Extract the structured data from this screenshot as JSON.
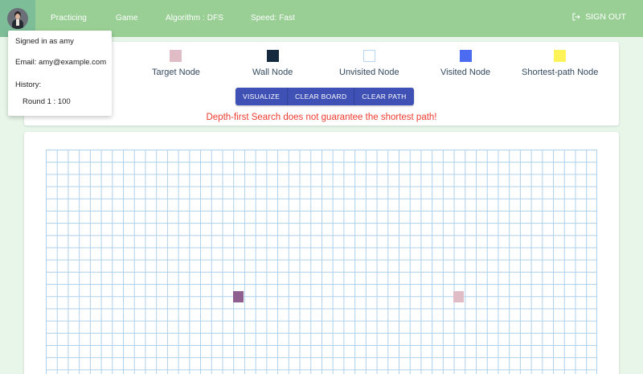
{
  "nav": {
    "items": [
      "Practicing",
      "Game",
      "Algorithm : DFS",
      "Speed: Fast"
    ],
    "signout": "SIGN OUT"
  },
  "user_menu": {
    "signed_in": "Signed in as amy",
    "email": "Email: amy@example.com",
    "history_label": "History:",
    "rounds": [
      "Round 1 : 100"
    ]
  },
  "legend": [
    {
      "label": "Target Node",
      "color": "#dfbcc6"
    },
    {
      "label": "Wall Node",
      "color": "#152a3f"
    },
    {
      "label": "Unvisited Node",
      "color": "#ffffff"
    },
    {
      "label": "Visited Node",
      "color": "#4b6cf0"
    },
    {
      "label": "Shortest-path Node",
      "color": "#fff35a"
    }
  ],
  "actions": {
    "visualize": "VISUALIZE",
    "clear_board": "CLEAR BOARD",
    "clear_path": "CLEAR PATH"
  },
  "warning": "Depth-first Search does not guarantee the shortest path!",
  "colors": {
    "topbar": "#99cf95",
    "accent": "#3f51b5",
    "warning": "#ee3a2f",
    "start_node": "#8e5f8f",
    "target_node": "#dfbcc6",
    "grid_line": "#aed0ea"
  }
}
